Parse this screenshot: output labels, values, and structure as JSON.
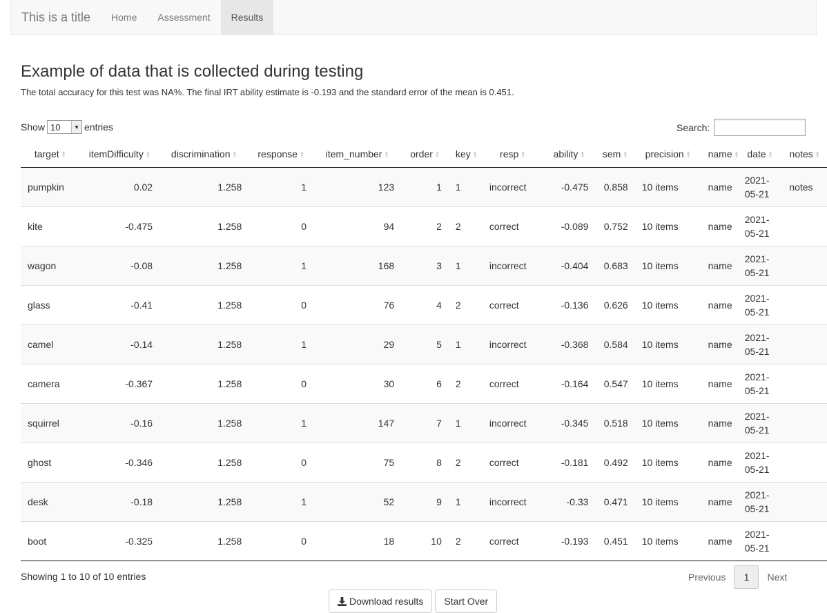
{
  "navbar": {
    "brand": "This is a title",
    "items": [
      {
        "label": "Home"
      },
      {
        "label": "Assessment"
      },
      {
        "label": "Results"
      }
    ],
    "active": "Results"
  },
  "page": {
    "title": "Example of data that is collected during testing",
    "summary": "The total accuracy for this test was NA%. The final IRT ability estimate is -0.193 and the standard error of the mean is 0.451."
  },
  "table_controls": {
    "show_label": "Show",
    "entries_value": "10",
    "entries_label": "entries",
    "search_label": "Search:"
  },
  "table": {
    "columns": [
      "target",
      "itemDifficulty",
      "discrimination",
      "response",
      "item_number",
      "order",
      "key",
      "resp",
      "ability",
      "sem",
      "precision",
      "name",
      "date",
      "notes"
    ],
    "rows": [
      [
        "pumpkin",
        "0.02",
        "1.258",
        "1",
        "123",
        "1",
        "1",
        "incorrect",
        "-0.475",
        "0.858",
        "10 items",
        "name",
        "2021-05-21",
        "notes"
      ],
      [
        "kite",
        "-0.475",
        "1.258",
        "0",
        "94",
        "2",
        "2",
        "correct",
        "-0.089",
        "0.752",
        "10 items",
        "name",
        "2021-05-21",
        ""
      ],
      [
        "wagon",
        "-0.08",
        "1.258",
        "1",
        "168",
        "3",
        "1",
        "incorrect",
        "-0.404",
        "0.683",
        "10 items",
        "name",
        "2021-05-21",
        ""
      ],
      [
        "glass",
        "-0.41",
        "1.258",
        "0",
        "76",
        "4",
        "2",
        "correct",
        "-0.136",
        "0.626",
        "10 items",
        "name",
        "2021-05-21",
        ""
      ],
      [
        "camel",
        "-0.14",
        "1.258",
        "1",
        "29",
        "5",
        "1",
        "incorrect",
        "-0.368",
        "0.584",
        "10 items",
        "name",
        "2021-05-21",
        ""
      ],
      [
        "camera",
        "-0.367",
        "1.258",
        "0",
        "30",
        "6",
        "2",
        "correct",
        "-0.164",
        "0.547",
        "10 items",
        "name",
        "2021-05-21",
        ""
      ],
      [
        "squirrel",
        "-0.16",
        "1.258",
        "1",
        "147",
        "7",
        "1",
        "incorrect",
        "-0.345",
        "0.518",
        "10 items",
        "name",
        "2021-05-21",
        ""
      ],
      [
        "ghost",
        "-0.346",
        "1.258",
        "0",
        "75",
        "8",
        "2",
        "correct",
        "-0.181",
        "0.492",
        "10 items",
        "name",
        "2021-05-21",
        ""
      ],
      [
        "desk",
        "-0.18",
        "1.258",
        "1",
        "52",
        "9",
        "1",
        "incorrect",
        "-0.33",
        "0.471",
        "10 items",
        "name",
        "2021-05-21",
        ""
      ],
      [
        "boot",
        "-0.325",
        "1.258",
        "0",
        "18",
        "10",
        "2",
        "correct",
        "-0.193",
        "0.451",
        "10 items",
        "name",
        "2021-05-21",
        ""
      ]
    ]
  },
  "footer": {
    "info": "Showing 1 to 10 of 10 entries",
    "previous": "Previous",
    "current_page": "1",
    "next": "Next"
  },
  "buttons": {
    "download": "Download results",
    "start_over": "Start Over"
  }
}
